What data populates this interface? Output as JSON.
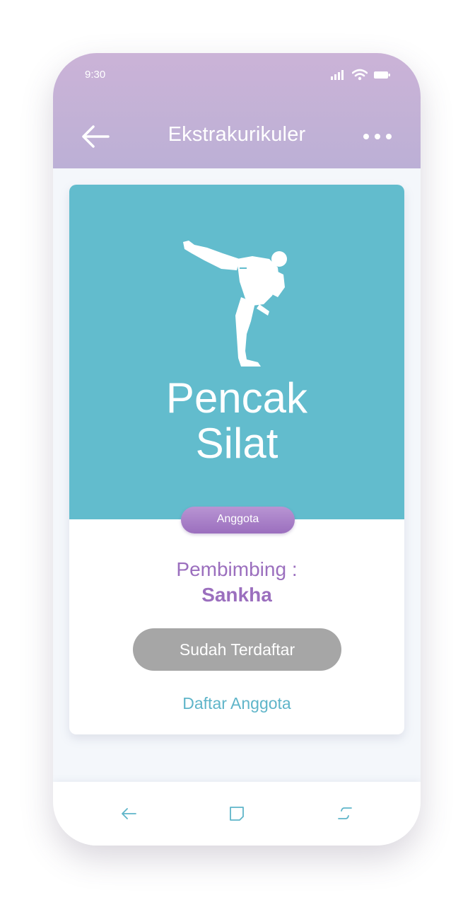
{
  "status_bar": {
    "time": "9:30",
    "icons": [
      "signal-icon",
      "wifi-icon",
      "battery-icon"
    ]
  },
  "header": {
    "title": "Ekstrakurikuler",
    "back_icon": "arrow-left-icon",
    "menu_icon": "more-horizontal-icon"
  },
  "club": {
    "name_line1": "Pencak",
    "name_line2": "Silat",
    "illustration": "martial-artist-kick-icon",
    "badge": "Anggota",
    "coach_label": "Pembimbing :",
    "coach_name": "Sankha",
    "status_button": "Sudah Terdaftar",
    "members_link": "Daftar Anggota"
  },
  "nav_bar": {
    "icons": [
      "nav-back-icon",
      "nav-home-icon",
      "nav-recents-icon"
    ]
  },
  "colors": {
    "header": "#c4b2d8",
    "hero": "#62bccd",
    "accent_purple": "#9b6fbe",
    "button_gray": "#a6a6a6",
    "link_teal": "#5fb5c9"
  }
}
